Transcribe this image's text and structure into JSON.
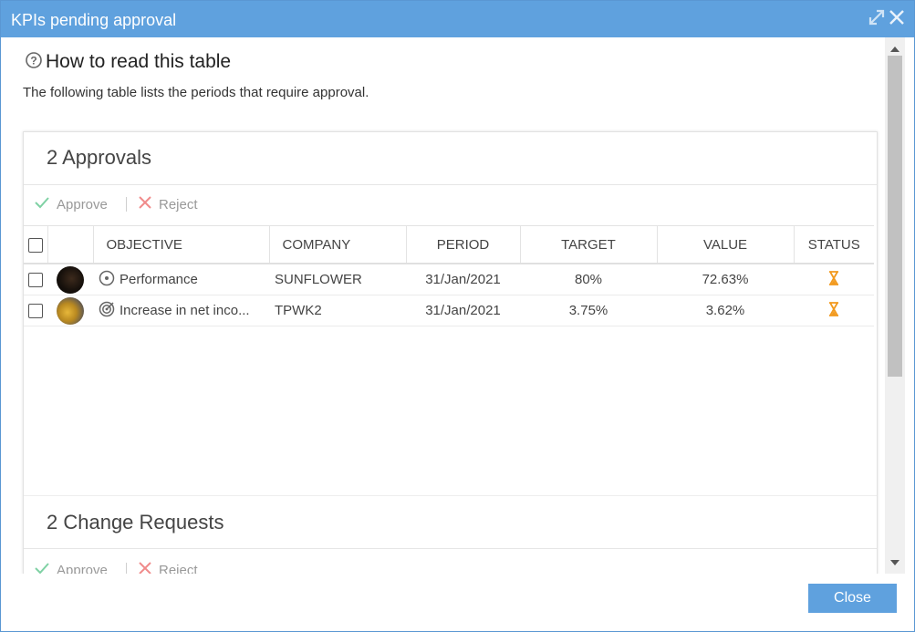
{
  "window": {
    "title": "KPIs pending approval"
  },
  "help": {
    "heading": "How to read this table",
    "description": "The following table lists the periods that require approval."
  },
  "approvals": {
    "title": "2 Approvals",
    "approve_label": "Approve",
    "reject_label": "Reject",
    "columns": {
      "objective": "OBJECTIVE",
      "company": "COMPANY",
      "period": "PERIOD",
      "target": "TARGET",
      "value": "VALUE",
      "status": "STATUS"
    },
    "rows": [
      {
        "objective": "Performance",
        "company": "SUNFLOWER",
        "period": "31/Jan/2021",
        "target": "80%",
        "value": "72.63%",
        "objective_icon": "circle-dot-icon",
        "status_icon": "hourglass-icon"
      },
      {
        "objective": "Increase in net inco...",
        "company": "TPWK2",
        "period": "31/Jan/2021",
        "target": "3.75%",
        "value": "3.62%",
        "objective_icon": "target-icon",
        "status_icon": "hourglass-icon"
      }
    ]
  },
  "change_requests": {
    "title": "2 Change Requests",
    "approve_label": "Approve",
    "reject_label": "Reject"
  },
  "footer": {
    "close_label": "Close"
  },
  "colors": {
    "titlebar": "#5fa1de",
    "approve_check": "#7fd1a4",
    "reject_x": "#f08b8b",
    "status_pending": "#f29a1e"
  }
}
